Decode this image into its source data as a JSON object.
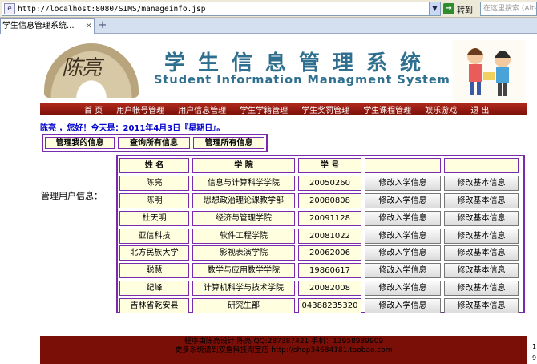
{
  "browser": {
    "url": "http://localhost:8080/SIMS/manageinfo.jsp",
    "go_label": "转到",
    "search_placeholder": "在这里搜索 (Alt+",
    "tab_title": "学生信息管理系统..."
  },
  "banner": {
    "title_cn": "学生信息管理系统",
    "title_en": "Student Information Managment System",
    "logo_text": "陈亮"
  },
  "nav": {
    "items": [
      "首 页",
      "用户帐号管理",
      "用户信息管理",
      "学生学籍管理",
      "学生奖罚管理",
      "学生课程管理",
      "娱乐游戏",
      "退 出"
    ]
  },
  "greeting": "陈亮 ，您好！今天是：2011年4月3日『星期日』。",
  "manage_tabs": [
    "管理我的信息",
    "查询所有信息",
    "管理所有信息"
  ],
  "side_label": "管理用户信息：",
  "table": {
    "headers": [
      "姓 名",
      "学 院",
      "学 号",
      "",
      ""
    ],
    "button_admission": "修改入学信息",
    "button_basic": "修改基本信息",
    "rows": [
      {
        "name": "陈亮",
        "college": "信息与计算科学学院",
        "id": "20050260"
      },
      {
        "name": "陈明",
        "college": "思想政治理论课教学部",
        "id": "20080808"
      },
      {
        "name": "杜天明",
        "college": "经济与管理学院",
        "id": "20091128"
      },
      {
        "name": "亚信科技",
        "college": "软件工程学院",
        "id": "20081022"
      },
      {
        "name": "北方民族大学",
        "college": "影视表演学院",
        "id": "20062006"
      },
      {
        "name": "聪慧",
        "college": "数学与应用数学学院",
        "id": "19860617"
      },
      {
        "name": "纪峰",
        "college": "计算机科学与技术学院",
        "id": "20082008"
      },
      {
        "name": "吉林省乾安县",
        "college": "研究生部",
        "id": "04388235320"
      }
    ]
  },
  "footer": {
    "line1": "程序由陈亮设计  陈亮 QQ:287387421  手机：13958989909",
    "line2": "更多系统请到双鱼科技淘宝店 http://shop34684181.taobao.com"
  },
  "side_nums": [
    "1",
    "9"
  ],
  "colors": {
    "accent_red": "#7a0f08",
    "border_purple": "#7a2bab",
    "cell_bg": "#ffffe0",
    "title_blue": "#2f6f8f"
  }
}
